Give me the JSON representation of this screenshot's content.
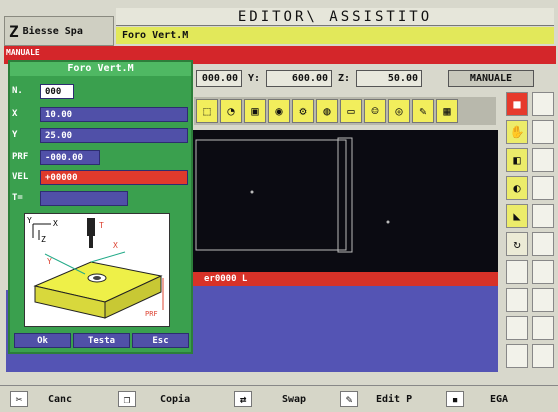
{
  "header": {
    "logo_glyph": "Z",
    "company": "Biesse Spa",
    "title": "EDITOR\\ ASSISTITO",
    "file_name": "Foro Vert.M",
    "red_label": "MANUALE"
  },
  "coords": {
    "x_value": "000.00",
    "y_label": "Y:",
    "y_value": "600.00",
    "z_label": "Z:",
    "z_value": "50.00",
    "mode": "MANUALE"
  },
  "toolbar": {
    "icons": [
      "tool-icon",
      "drill-icon",
      "saw-icon",
      "mill-icon",
      "gear-icon",
      "router-icon",
      "plane-icon",
      "face-icon",
      "bore-icon",
      "pen-icon",
      "grid-icon"
    ]
  },
  "sidebar": {
    "icons": [
      "stop-icon",
      "hand-icon",
      "tool-change-icon",
      "spindle-icon",
      "edge-icon",
      "cycle-icon"
    ]
  },
  "dialog": {
    "title": "Foro Vert.M",
    "fields": [
      {
        "label": "N.",
        "value": "000"
      },
      {
        "label": "X",
        "value": "10.00"
      },
      {
        "label": "Y",
        "value": "25.00"
      },
      {
        "label": "PRF",
        "value": "-000.00"
      },
      {
        "label": "VEL",
        "value": "+00000"
      },
      {
        "label": "T=",
        "value": ""
      }
    ],
    "diagram": {
      "axis_y": "Y",
      "axis_x": "X",
      "axis_z": "Z",
      "tool": "T",
      "dim_x": "X",
      "dim_y": "Y",
      "depth": "PRF"
    },
    "buttons": {
      "ok": "Ok",
      "text": "Testa",
      "esc": "Esc"
    }
  },
  "viewport": {
    "status_text": "er0000 L"
  },
  "bottom": {
    "cancel": "Canc",
    "copy": "Copia",
    "swap": "Swap",
    "edit": "Edit P",
    "ega": "EGA"
  },
  "colors": {
    "dialog_green": "#3aa04e",
    "field_blue": "#5050a8",
    "alert_red": "#d4262a",
    "highlight_yellow": "#e2e85a"
  }
}
